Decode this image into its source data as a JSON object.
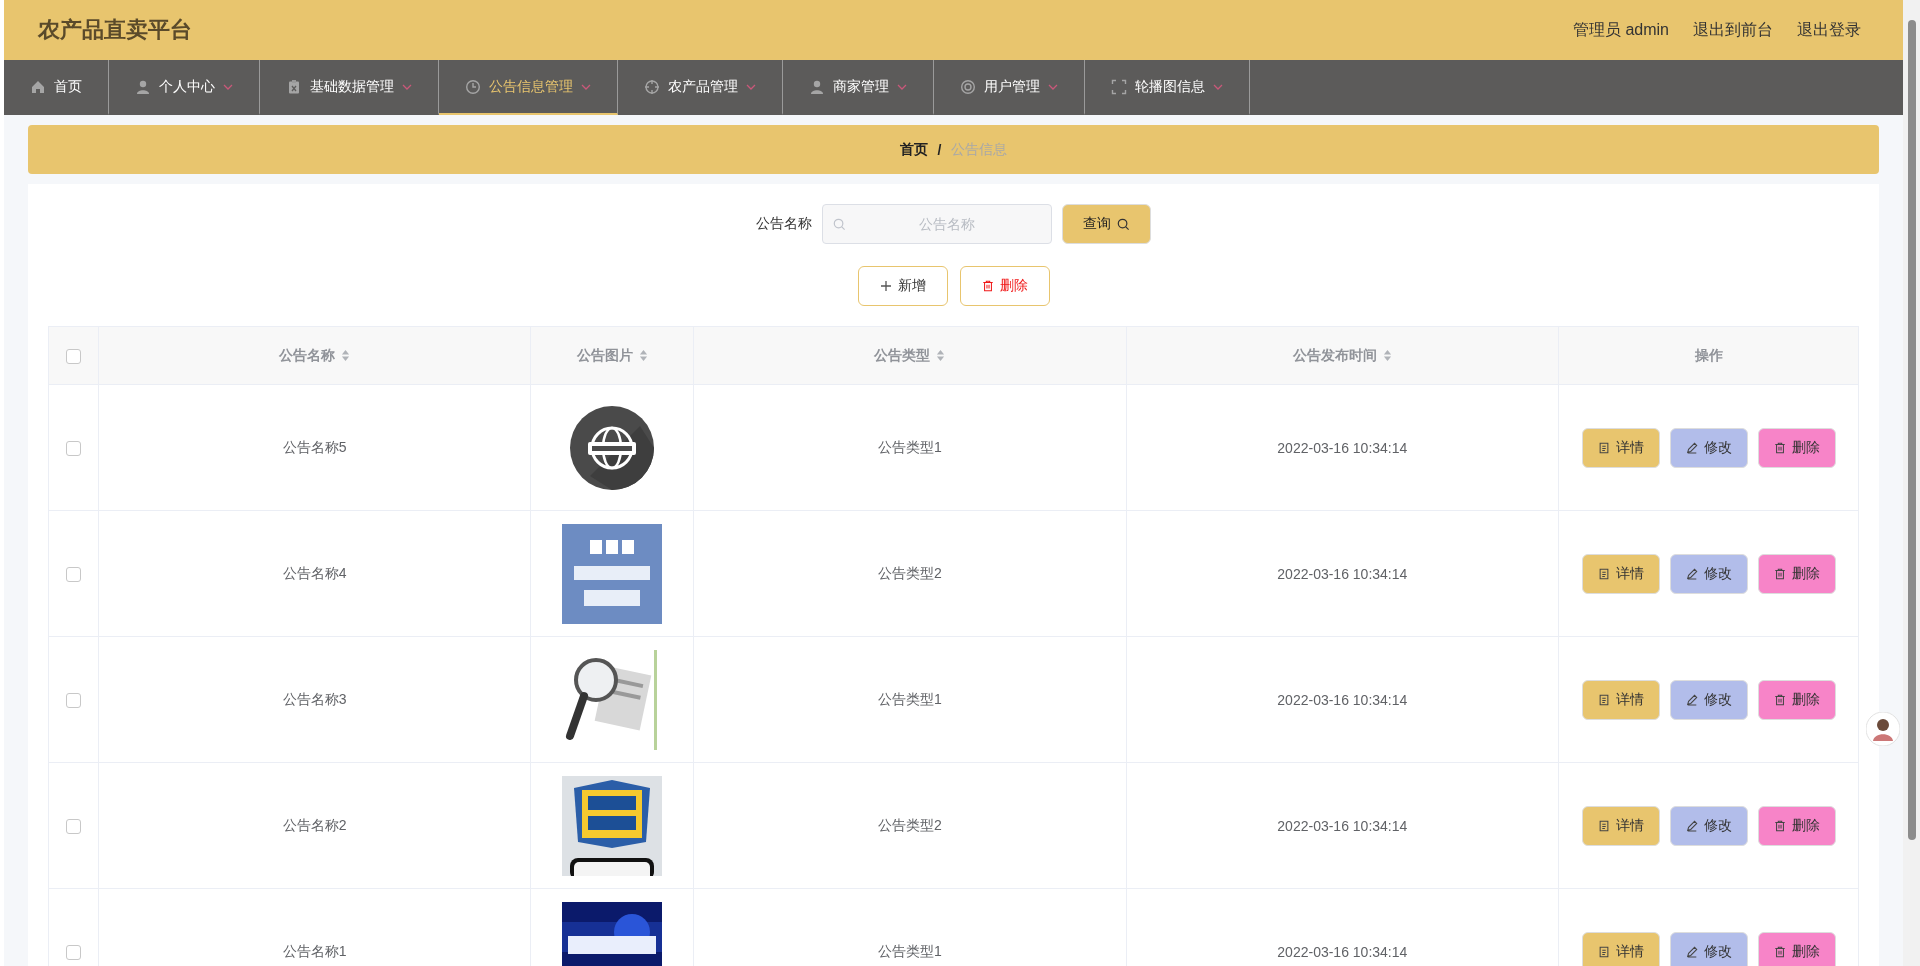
{
  "header": {
    "title": "农产品直卖平台",
    "links": [
      "管理员 admin",
      "退出到前台",
      "退出登录"
    ]
  },
  "nav": [
    {
      "label": "首页",
      "has_menu": false,
      "selected": false
    },
    {
      "label": "个人中心",
      "has_menu": true,
      "selected": false
    },
    {
      "label": "基础数据管理",
      "has_menu": true,
      "selected": false
    },
    {
      "label": "公告信息管理",
      "has_menu": true,
      "selected": true
    },
    {
      "label": "农产品管理",
      "has_menu": true,
      "selected": false
    },
    {
      "label": "商家管理",
      "has_menu": true,
      "selected": false
    },
    {
      "label": "用户管理",
      "has_menu": true,
      "selected": false
    },
    {
      "label": "轮播图信息",
      "has_menu": true,
      "selected": false
    }
  ],
  "breadcrumb": {
    "items": [
      "首页",
      "公告信息"
    ],
    "separator": "/"
  },
  "search": {
    "label": "公告名称",
    "placeholder": "公告名称",
    "button": "查询"
  },
  "actions": [
    {
      "label": "新增",
      "kind": "add"
    },
    {
      "label": "删除",
      "kind": "delete"
    }
  ],
  "table": {
    "select_all": {
      "checked": false
    },
    "columns": [
      {
        "label": "公告名称",
        "sortable": true
      },
      {
        "label": "公告图片",
        "sortable": true
      },
      {
        "label": "公告类型",
        "sortable": true
      },
      {
        "label": "公告发布时间",
        "sortable": true
      },
      {
        "label": "操作",
        "sortable": false
      }
    ],
    "rows": [
      {
        "name": "公告名称5",
        "type": "公告类型1",
        "time": "2022-03-16 10:34:14",
        "selected": false,
        "buttons": [
          {
            "label": "详情",
            "kind": "detail"
          },
          {
            "label": "修改",
            "kind": "edit"
          },
          {
            "label": "删除",
            "kind": "delete"
          }
        ]
      },
      {
        "name": "公告名称4",
        "type": "公告类型2",
        "time": "2022-03-16 10:34:14",
        "selected": false,
        "buttons": [
          {
            "label": "详情",
            "kind": "detail"
          },
          {
            "label": "修改",
            "kind": "edit"
          },
          {
            "label": "删除",
            "kind": "delete"
          }
        ]
      },
      {
        "name": "公告名称3",
        "type": "公告类型1",
        "time": "2022-03-16 10:34:14",
        "selected": false,
        "buttons": [
          {
            "label": "详情",
            "kind": "detail"
          },
          {
            "label": "修改",
            "kind": "edit"
          },
          {
            "label": "删除",
            "kind": "delete"
          }
        ]
      },
      {
        "name": "公告名称2",
        "type": "公告类型2",
        "time": "2022-03-16 10:34:14",
        "selected": false,
        "buttons": [
          {
            "label": "详情",
            "kind": "detail"
          },
          {
            "label": "修改",
            "kind": "edit"
          },
          {
            "label": "删除",
            "kind": "delete"
          }
        ]
      },
      {
        "name": "公告名称1",
        "type": "公告类型1",
        "time": "2022-03-16 10:34:14",
        "selected": false,
        "buttons": [
          {
            "label": "详情",
            "kind": "detail"
          },
          {
            "label": "修改",
            "kind": "edit"
          },
          {
            "label": "删除",
            "kind": "delete"
          }
        ]
      }
    ]
  }
}
